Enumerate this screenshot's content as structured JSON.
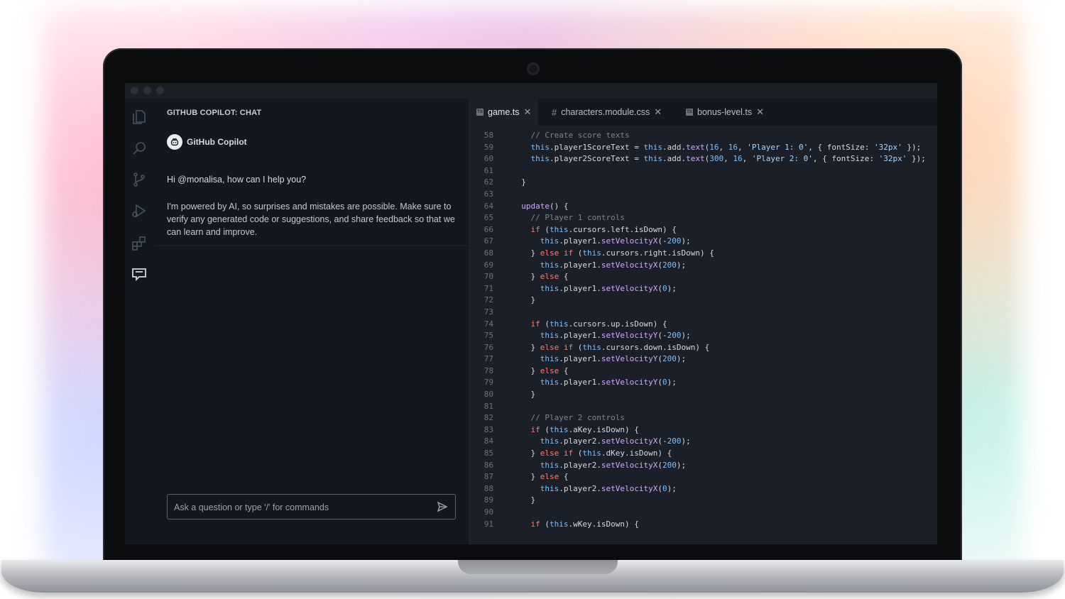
{
  "chat": {
    "panel_title": "GITHUB COPILOT: CHAT",
    "bot_name": "GitHub Copilot",
    "greeting": "Hi @monalisa, how can I help you?",
    "disclaimer": "I'm powered by AI, so surprises and mistakes are possible. Make sure to verify any generated code or suggestions, and share feedback so that we can learn and improve.",
    "input_placeholder": "Ask a question or type '/' for commands"
  },
  "editor": {
    "tabs": [
      {
        "label": "game.ts",
        "type": "ts",
        "active": true
      },
      {
        "label": "characters.module.css",
        "type": "css",
        "active": false
      },
      {
        "label": "bonus-level.ts",
        "type": "ts",
        "active": false
      }
    ],
    "lines": [
      {
        "n": "58",
        "code": "    // Create score texts"
      },
      {
        "n": "59",
        "code": "    this.player1ScoreText = this.add.text(16, 16, 'Player 1: 0', { fontSize: '32px' });"
      },
      {
        "n": "60",
        "code": "    this.player2ScoreText = this.add.text(300, 16, 'Player 2: 0', { fontSize: '32px' });"
      },
      {
        "n": "61",
        "code": ""
      },
      {
        "n": "62",
        "code": "  }"
      },
      {
        "n": "63",
        "code": ""
      },
      {
        "n": "64",
        "code": "  update() {"
      },
      {
        "n": "65",
        "code": "    // Player 1 controls"
      },
      {
        "n": "66",
        "code": "    if (this.cursors.left.isDown) {"
      },
      {
        "n": "67",
        "code": "      this.player1.setVelocityX(-200);"
      },
      {
        "n": "68",
        "code": "    } else if (this.cursors.right.isDown) {"
      },
      {
        "n": "69",
        "code": "      this.player1.setVelocityX(200);"
      },
      {
        "n": "70",
        "code": "    } else {"
      },
      {
        "n": "71",
        "code": "      this.player1.setVelocityX(0);"
      },
      {
        "n": "72",
        "code": "    }"
      },
      {
        "n": "73",
        "code": ""
      },
      {
        "n": "74",
        "code": "    if (this.cursors.up.isDown) {"
      },
      {
        "n": "75",
        "code": "      this.player1.setVelocityY(-200);"
      },
      {
        "n": "76",
        "code": "    } else if (this.cursors.down.isDown) {"
      },
      {
        "n": "77",
        "code": "      this.player1.setVelocityY(200);"
      },
      {
        "n": "78",
        "code": "    } else {"
      },
      {
        "n": "79",
        "code": "      this.player1.setVelocityY(0);"
      },
      {
        "n": "80",
        "code": "    }"
      },
      {
        "n": "81",
        "code": ""
      },
      {
        "n": "82",
        "code": "    // Player 2 controls"
      },
      {
        "n": "83",
        "code": "    if (this.aKey.isDown) {"
      },
      {
        "n": "84",
        "code": "      this.player2.setVelocityX(-200);"
      },
      {
        "n": "85",
        "code": "    } else if (this.dKey.isDown) {"
      },
      {
        "n": "86",
        "code": "      this.player2.setVelocityX(200);"
      },
      {
        "n": "87",
        "code": "    } else {"
      },
      {
        "n": "88",
        "code": "      this.player2.setVelocityX(0);"
      },
      {
        "n": "89",
        "code": "    }"
      },
      {
        "n": "90",
        "code": ""
      },
      {
        "n": "91",
        "code": "    if (this.wKey.isDown) {"
      }
    ]
  },
  "activity_bar": {
    "icons": [
      "files-icon",
      "search-icon",
      "source-control-icon",
      "run-debug-icon",
      "extensions-icon",
      "chat-icon"
    ],
    "active": "chat-icon"
  }
}
